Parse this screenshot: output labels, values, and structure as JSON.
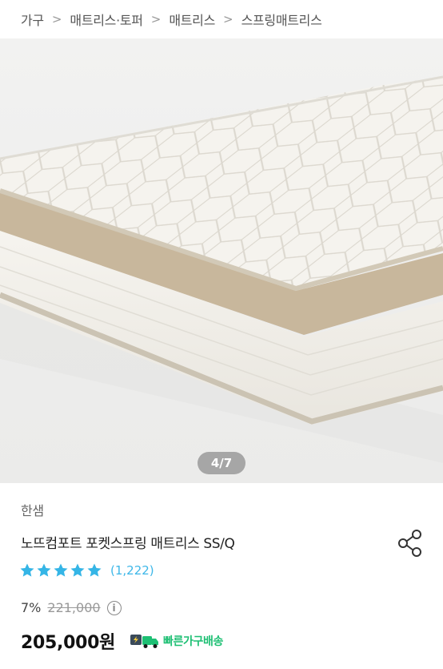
{
  "breadcrumb": {
    "items": [
      "가구",
      "매트리스·토퍼",
      "매트리스",
      "스프링매트리스"
    ]
  },
  "gallery": {
    "page_indicator": "4/7"
  },
  "product": {
    "brand": "한샘",
    "title": "노뜨컴포트 포켓스프링 매트리스 SS/Q",
    "rating": 5,
    "review_count": "(1,222)",
    "discount": "7%",
    "original_price": "221,000",
    "price": "205,000원",
    "delivery_label": "빠른가구배송"
  },
  "colors": {
    "star": "#35b5e6",
    "review_count": "#3db7e8",
    "delivery": "#1dbf73"
  },
  "icons": {
    "share": "share-icon",
    "info": "info-icon",
    "truck": "fast-delivery-truck-icon"
  }
}
